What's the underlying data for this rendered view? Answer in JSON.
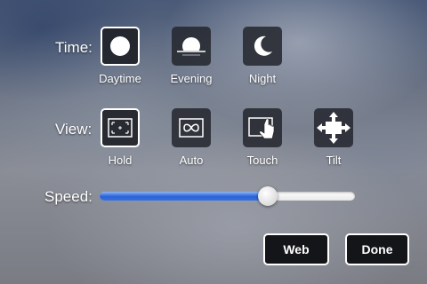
{
  "time": {
    "label": "Time:",
    "options": [
      {
        "label": "Daytime",
        "icon": "sun-icon",
        "selected": true
      },
      {
        "label": "Evening",
        "icon": "sunset-icon",
        "selected": false
      },
      {
        "label": "Night",
        "icon": "moon-icon",
        "selected": false
      }
    ]
  },
  "view": {
    "label": "View:",
    "options": [
      {
        "label": "Hold",
        "icon": "hold-frame-icon",
        "selected": true
      },
      {
        "label": "Auto",
        "icon": "infinity-icon",
        "selected": false
      },
      {
        "label": "Touch",
        "icon": "touch-hand-icon",
        "selected": false
      },
      {
        "label": "Tilt",
        "icon": "tilt-arrows-icon",
        "selected": false
      }
    ]
  },
  "speed": {
    "label": "Speed:",
    "value_fraction": 0.66
  },
  "buttons": {
    "web": "Web",
    "done": "Done"
  }
}
